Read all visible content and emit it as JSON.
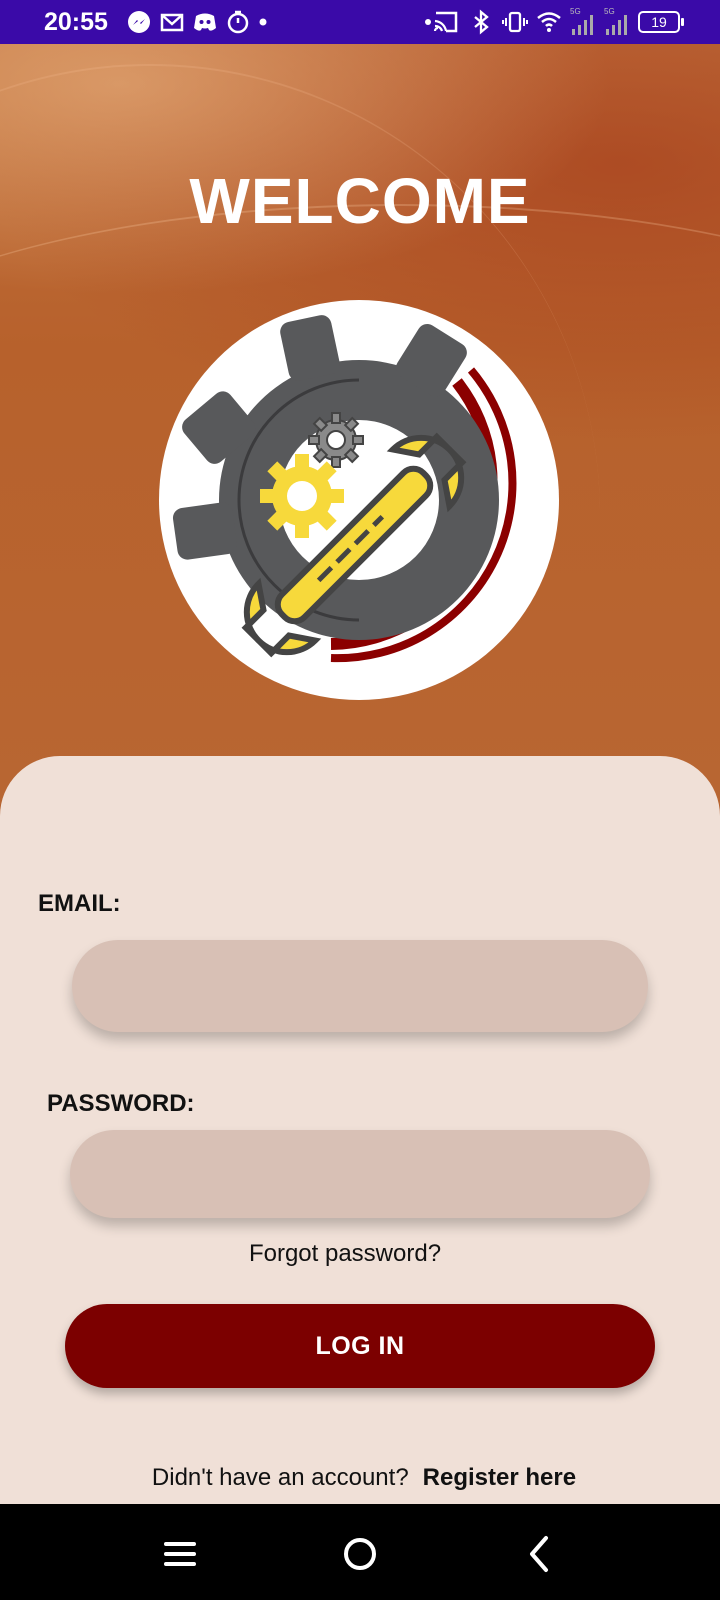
{
  "status_bar": {
    "time": "20:55",
    "left_icons": [
      "messenger-icon",
      "gmail-icon",
      "discord-icon",
      "timer-icon",
      "dot-icon"
    ],
    "right_icons": [
      "cast-icon",
      "bluetooth-icon",
      "vibrate-icon",
      "wifi-icon",
      "signal-5g-icon",
      "signal-5g-icon"
    ],
    "network_label": "5G",
    "battery": "19"
  },
  "hero": {
    "title": "WELCOME",
    "logo": "gear-wrench-logo"
  },
  "form": {
    "email_label": "EMAIL:",
    "email_value": "",
    "password_label": "PASSWORD:",
    "password_value": "",
    "forgot_password": "Forgot password?",
    "login_button": "LOG IN",
    "register_prompt": "Didn't have an account?",
    "register_link": "Register here"
  },
  "nav_bar": {
    "buttons": [
      "menu-icon",
      "home-icon",
      "back-icon"
    ]
  },
  "colors": {
    "status_bar": "#3a0aa8",
    "accent": "#7c0000",
    "card": "#f0e0d7",
    "field": "#d8c0b5"
  }
}
